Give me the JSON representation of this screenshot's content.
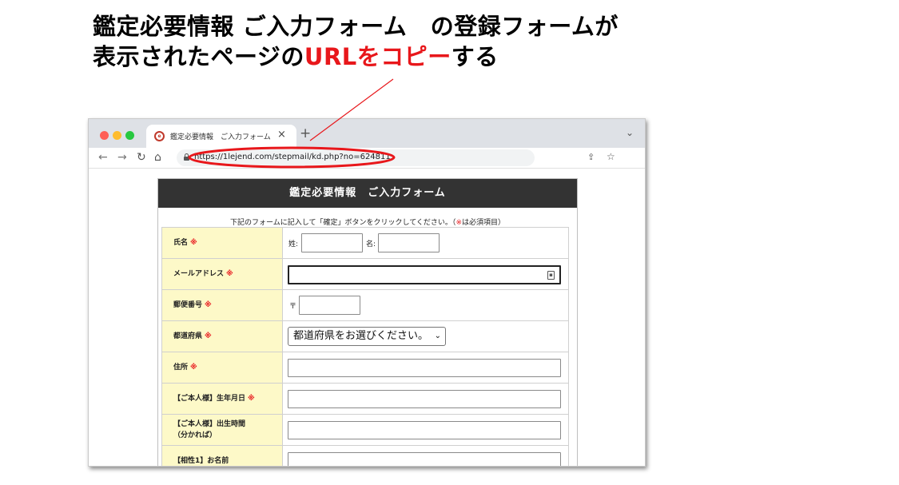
{
  "headline": {
    "line1": "鑑定必要情報 ご入力フォーム　の登録フォームが",
    "line2_prefix": "表示されたページの",
    "line2_highlight": "URLをコピー",
    "line2_suffix": "する"
  },
  "colors": {
    "highlight": "#e8171b",
    "header_bg": "#333333",
    "label_bg": "#fdf9c8"
  },
  "browser": {
    "tab_title": "鑑定必要情報　ご入力フォーム",
    "tab_close": "×",
    "new_tab": "+",
    "tab_menu": "⌄",
    "url": "https://1lejend.com/stepmail/kd.php?no=624811",
    "icons": [
      "back-arrow-icon",
      "forward-arrow-icon",
      "reload-icon",
      "home-icon",
      "lock-icon",
      "share-icon",
      "star-icon"
    ]
  },
  "form": {
    "title": "鑑定必要情報　ご入力フォーム",
    "instruction_main": "下記のフォームに記入して「確定」ボタンをクリックしてください。（",
    "instruction_mark": "※",
    "instruction_tail": "は必須項目）",
    "required_mark": "※",
    "rows": [
      {
        "label": "氏名",
        "sei_label": "姓:",
        "mei_label": "名:"
      },
      {
        "label": "メールアドレス"
      },
      {
        "label": "郵便番号",
        "prefix": "〒"
      },
      {
        "label": "都道府県",
        "select_value": "都道府県をお選びください。"
      },
      {
        "label": "住所"
      },
      {
        "label": "【ご本人様】生年月日"
      },
      {
        "label_line1": "【ご本人様】出生時間",
        "label_line2": "（分かれば）"
      },
      {
        "label": "【相性1】お名前"
      }
    ]
  }
}
